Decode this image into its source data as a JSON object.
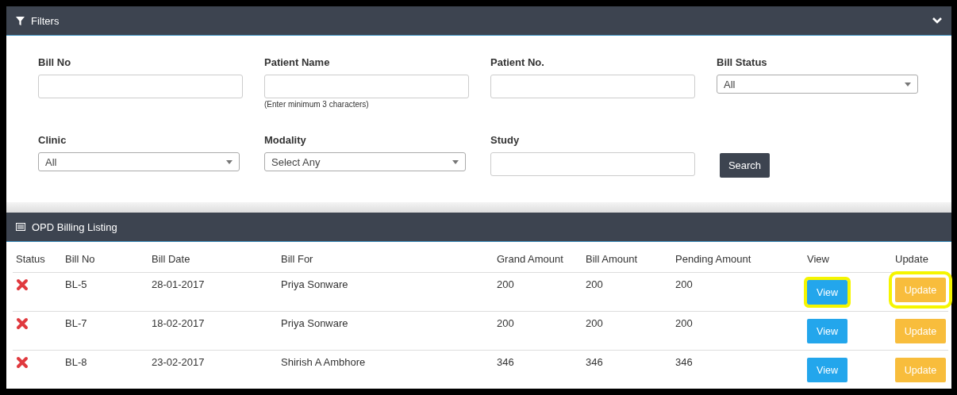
{
  "filters": {
    "title": "Filters",
    "expanded": true,
    "fields": [
      {
        "kind": "input",
        "label": "Bill No"
      },
      {
        "kind": "input",
        "label": "Patient Name",
        "hint": "(Enter minimum 3 characters)"
      },
      {
        "kind": "input",
        "label": "Patient No."
      },
      {
        "kind": "select",
        "label": "Bill Status",
        "value": "All"
      },
      {
        "kind": "select",
        "label": "Clinic",
        "value": "All"
      },
      {
        "kind": "select",
        "label": "Modality",
        "value": "Select Any"
      },
      {
        "kind": "input",
        "label": "Study"
      },
      {
        "kind": "button",
        "label": "Search"
      }
    ]
  },
  "listing": {
    "title": "OPD Billing Listing",
    "columns": [
      "Status",
      "Bill No",
      "Bill Date",
      "Bill For",
      "Grand Amount",
      "Bill Amount",
      "Pending Amount",
      "View",
      "Update"
    ],
    "rows": [
      {
        "paid": false,
        "bill_no": "BL-5",
        "bill_date": "28-01-2017",
        "bill_for": "Priya Sonware",
        "grand_amount": "200",
        "bill_amount": "200",
        "pending_amount": "200",
        "view": "View",
        "update": "Update",
        "highlighted": true
      },
      {
        "paid": false,
        "bill_no": "BL-7",
        "bill_date": "18-02-2017",
        "bill_for": "Priya Sonware",
        "grand_amount": "200",
        "bill_amount": "200",
        "pending_amount": "200",
        "view": "View",
        "update": "Update",
        "highlighted": false
      },
      {
        "paid": false,
        "bill_no": "BL-8",
        "bill_date": "23-02-2017",
        "bill_for": "Shirish A Ambhore",
        "grand_amount": "346",
        "bill_amount": "346",
        "pending_amount": "346",
        "view": "View",
        "update": "Update",
        "highlighted": false
      }
    ]
  }
}
